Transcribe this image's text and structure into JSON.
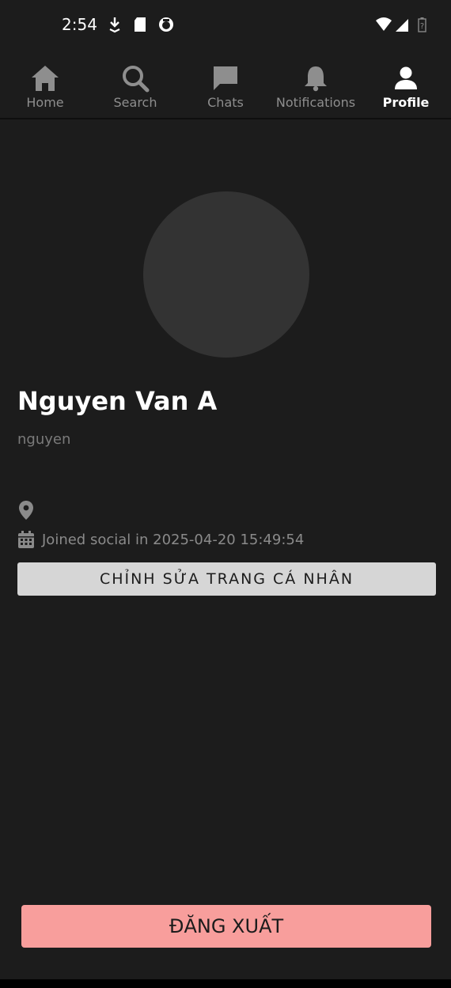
{
  "status_bar": {
    "time": "2:54",
    "left_icons": [
      "download-icon",
      "sd-card-icon",
      "app-notification-icon"
    ],
    "right_icons": [
      "wifi-icon",
      "cell-signal-icon",
      "battery-icon"
    ]
  },
  "nav": {
    "items": [
      {
        "label": "Home",
        "icon": "home-icon",
        "active": false
      },
      {
        "label": "Search",
        "icon": "search-icon",
        "active": false
      },
      {
        "label": "Chats",
        "icon": "chat-icon",
        "active": false
      },
      {
        "label": "Notifications",
        "icon": "bell-icon",
        "active": false
      },
      {
        "label": "Profile",
        "icon": "person-icon",
        "active": true
      }
    ],
    "active_color": "#ffffff",
    "inactive_color": "#8e8e8e"
  },
  "profile": {
    "display_name": "Nguyen Van A",
    "username": "nguyen",
    "location": "",
    "joined": "Joined social in 2025-04-20 15:49:54",
    "avatar_color": "#333333"
  },
  "actions": {
    "edit_label": "CHỈNH SỬA TRANG CÁ NHÂN",
    "logout_label": "ĐĂNG XUẤT",
    "logout_color": "#f89e9c"
  }
}
